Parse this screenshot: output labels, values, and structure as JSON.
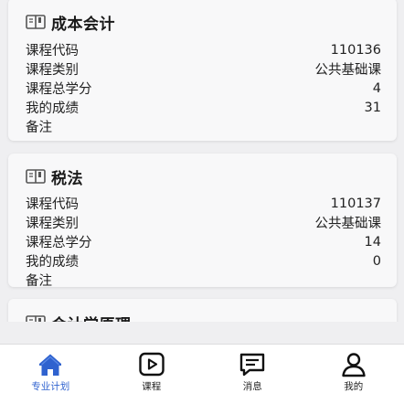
{
  "courses": [
    {
      "name": "成本会计",
      "fields": [
        {
          "label": "课程代码",
          "value": "110136"
        },
        {
          "label": "课程类别",
          "value": "公共基础课"
        },
        {
          "label": "课程总学分",
          "value": "4"
        },
        {
          "label": "我的成绩",
          "value": "31"
        },
        {
          "label": "备注",
          "value": ""
        }
      ]
    },
    {
      "name": "税法",
      "fields": [
        {
          "label": "课程代码",
          "value": "110137"
        },
        {
          "label": "课程类别",
          "value": "公共基础课"
        },
        {
          "label": "课程总学分",
          "value": "14"
        },
        {
          "label": "我的成绩",
          "value": "0"
        },
        {
          "label": "备注",
          "value": ""
        }
      ]
    },
    {
      "name": "会计学原理",
      "fields": []
    }
  ],
  "tabbar": {
    "items": [
      {
        "label": "专业计划",
        "icon": "home-icon",
        "active": true
      },
      {
        "label": "课程",
        "icon": "play-icon",
        "active": false
      },
      {
        "label": "消息",
        "icon": "message-icon",
        "active": false
      },
      {
        "label": "我的",
        "icon": "user-icon",
        "active": false
      }
    ]
  },
  "colors": {
    "accent": "#2f62cf",
    "background": "#efeff1",
    "card": "#f8f8f9"
  }
}
